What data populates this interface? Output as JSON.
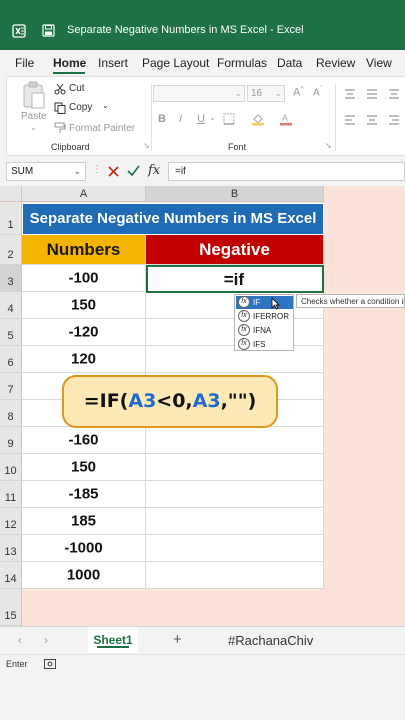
{
  "window": {
    "title": "Separate Negative Numbers in MS Excel  -  Excel"
  },
  "menu": {
    "tabs": [
      "File",
      "Home",
      "Insert",
      "Page Layout",
      "Formulas",
      "Data",
      "Review",
      "View"
    ],
    "active": "Home"
  },
  "ribbon": {
    "clipboard": {
      "paste": "Paste",
      "cut": "Cut",
      "copy": "Copy",
      "format_painter": "Format Painter",
      "group_label": "Clipboard"
    },
    "font": {
      "size": "16",
      "group_label": "Font"
    }
  },
  "formula_bar": {
    "name_box": "SUM",
    "fx": "fx",
    "content": "=if"
  },
  "columns": [
    "A",
    "B"
  ],
  "rows": [
    "1",
    "2",
    "3",
    "4",
    "5",
    "6",
    "7",
    "8",
    "9",
    "10",
    "11",
    "12",
    "13",
    "14",
    "15"
  ],
  "sheet": {
    "title": "Separate Negative Numbers in MS Excel",
    "header_a": "Numbers",
    "header_b": "Negative",
    "numbers": [
      "-100",
      "150",
      "-120",
      "120",
      "",
      "",
      "-160",
      "150",
      "-185",
      "185",
      "-1000",
      "1000"
    ],
    "active_cell_text": "=if"
  },
  "autocomplete": {
    "items": [
      "IF",
      "IFERROR",
      "IFNA",
      "IFS"
    ],
    "tooltip": "Checks whether a condition is met"
  },
  "callout": {
    "p1": "=IF(",
    "p2": "A3",
    "p3": "<0,",
    "p4": "A3",
    "p5": ",\"\")"
  },
  "tabs": {
    "sheet1": "Sheet1",
    "add": "+",
    "hashtag": "#RachanaChiv"
  },
  "status": {
    "mode": "Enter"
  },
  "colors": {
    "excel_green": "#1e7145",
    "title_blue": "#1f6bb5",
    "numbers_header": "#f5b400",
    "negative_header": "#c00000",
    "callout_fill": "#fde9b6",
    "callout_border": "#e0961c"
  }
}
